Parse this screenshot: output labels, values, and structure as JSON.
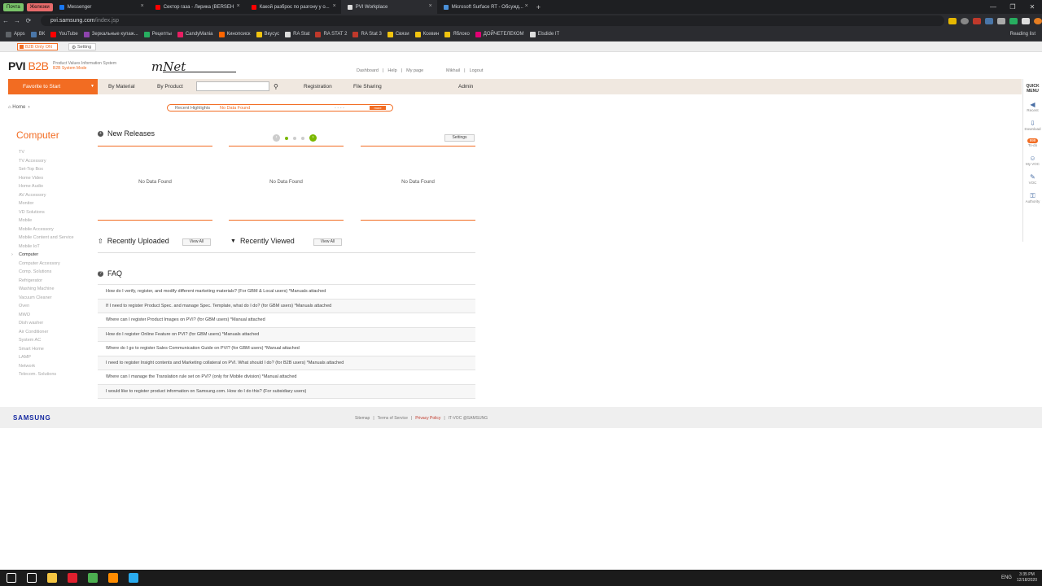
{
  "browser": {
    "pills": [
      {
        "label": "Почта",
        "color": "#7ac46a"
      },
      {
        "label": "Железки",
        "color": "#e86b6b"
      }
    ],
    "tabs": [
      {
        "title": "Messenger",
        "color": "#1877f2"
      },
      {
        "title": "Сектор газа - Лирика (BERSEH",
        "color": "#ff0000"
      },
      {
        "title": "Какой разброс по разгону у о...",
        "color": "#ff0000"
      },
      {
        "title": "PVI Workplace",
        "color": "#dddddd",
        "active": true
      },
      {
        "title": "Microsoft Surface RT - Обсужд...",
        "color": "#4a90d9"
      }
    ],
    "new_tab": "+",
    "controls": [
      "—",
      "❐",
      "✕"
    ],
    "nav": [
      "←",
      "→",
      "⟳"
    ],
    "url_host": "pvi.samsung.com",
    "url_path": "/index.jsp",
    "bookmarks": [
      {
        "label": "Apps",
        "color": "#5f6368"
      },
      {
        "label": "ВК",
        "color": "#4a76a8"
      },
      {
        "label": "YouTube",
        "color": "#ff0000"
      },
      {
        "label": "Зеркальные купаж...",
        "color": "#8e44ad"
      },
      {
        "label": "Рецепты",
        "color": "#27ae60"
      },
      {
        "label": "CandyMania",
        "color": "#e91e63"
      },
      {
        "label": "Кинопоиск",
        "color": "#ff6600"
      },
      {
        "label": "Вкусус",
        "color": "#f1c40f"
      },
      {
        "label": "RA Stat",
        "color": "#dddddd"
      },
      {
        "label": "RA STAT 2",
        "color": "#c0392b"
      },
      {
        "label": "RA Stat 3",
        "color": "#c0392b"
      },
      {
        "label": "Связи",
        "color": "#f1c40f"
      },
      {
        "label": "Ксевин",
        "color": "#f1c40f"
      },
      {
        "label": "Яблоко",
        "color": "#f1c40f"
      },
      {
        "label": "ДОЙЧЕТЕЛЕКОМ",
        "color": "#e20074"
      },
      {
        "label": "Elsdide IT",
        "color": "#dddddd"
      }
    ],
    "reading_list": "Reading list"
  },
  "topstrip": {
    "b2b_label": "B2B Only ON",
    "setting_label": "Setting"
  },
  "header": {
    "logo_main": "PVI",
    "logo_b2b": "B2B",
    "logo_sub1": "Product Values Information System",
    "logo_sub2": "B2B System Mode",
    "signature": "mNet",
    "util_links": [
      "Dashboard",
      "|",
      "Help",
      "|",
      "My page"
    ],
    "user": "Mikhail",
    "logout": "Logout"
  },
  "gnb": {
    "favorite": "Favorite to Start",
    "caret": "▼",
    "items": [
      {
        "label": "By Material"
      },
      {
        "label": "By Product"
      },
      {
        "label": "Registration"
      },
      {
        "label": "File Sharing"
      },
      {
        "label": "Admin"
      }
    ],
    "search_placeholder": ""
  },
  "quick_menu": {
    "title": "QUICK MENU",
    "items": [
      {
        "label": "Recent",
        "icon": "◀"
      },
      {
        "label": "Download",
        "icon": "⇩"
      },
      {
        "label": "To-do",
        "icon": "",
        "badge": "999"
      },
      {
        "label": "My VOC",
        "icon": "☺"
      },
      {
        "label": "VOC",
        "icon": "✎"
      },
      {
        "label": "Authority",
        "icon": "⚿"
      }
    ]
  },
  "breadcrumb": {
    "home": "Home",
    "sep": "›"
  },
  "highlights": {
    "label": "Recent Highlights",
    "value": "No Data Found",
    "dots": "- - - -",
    "more": "more"
  },
  "sidebar": {
    "category": "Computer",
    "items": [
      "TV",
      "TV Accessory",
      "Set-Top Box",
      "Home Video",
      "Home Audio",
      "AV Accessory",
      "Monitor",
      "VD Solutions",
      "Mobile",
      "Mobile Accessory",
      "Mobile Content and Service",
      "Mobile IoT",
      "Computer",
      "Computer Accessory",
      "Comp. Solutions",
      "Refrigerator",
      "Washing Machine",
      "Vacuum Cleaner",
      "Oven",
      "MWO",
      "Dish washer",
      "Air Conditioner",
      "System AC",
      "Smart Home",
      "LAMP",
      "Network",
      "Telecom. Solutions"
    ],
    "selected": "Computer"
  },
  "new_releases": {
    "title": "New Releases",
    "settings": "Settings",
    "columns": [
      "No Data Found",
      "No Data Found",
      "No Data Found"
    ]
  },
  "recently_uploaded": {
    "title": "Recently Uploaded",
    "view_all": "View All"
  },
  "recently_viewed": {
    "title": "Recently Viewed",
    "view_all": "View All"
  },
  "faq": {
    "title": "FAQ",
    "items": [
      "How do I verify, register, and modify different marketing materials? (For GBM & Local users) *Manuals attached",
      "If I need to register Product Spec. and manage Spec. Template, what do I do? (for GBM users) *Manuals attached",
      "Where can I register Product Images on PVI? (for GBM users) *Manual attached",
      "How do I register Online Feature on PVI? (for GBM users) *Manuals attached",
      "Where do I go to register Sales Communication Guide on PVI? (for GBM users) *Manual attached",
      "I need to register Insight contents and Marketing collateral on PVI. What should I do? (for B2B users) *Manuals attached",
      "Where can I manage the Translation rule set on PVI? (only for Mobile division) *Manual attached",
      "I would like to register product information on Samsung.com. How do I do this? (For subsidiary users)"
    ]
  },
  "footer": {
    "logo": "SAMSUNG",
    "links": [
      "Sitemap",
      "|",
      "Terms of Service",
      "|",
      "Privacy Policy",
      "|",
      "IT-VOC @SAMSUNG"
    ]
  },
  "taskbar": {
    "apps": [
      {
        "name": "start-icon",
        "color": "#ffffff"
      },
      {
        "name": "search-icon",
        "color": "#ffffff"
      },
      {
        "name": "explorer-icon",
        "color": "#f4c542"
      },
      {
        "name": "opera-icon",
        "color": "#e0202e"
      },
      {
        "name": "chrome-icon",
        "color": "#4caf50"
      },
      {
        "name": "firefox-icon",
        "color": "#ff8c00"
      },
      {
        "name": "telegram-icon",
        "color": "#2aabee"
      }
    ],
    "lang": "ENG",
    "time": "3:35 PM",
    "date": "12/18/2020"
  }
}
